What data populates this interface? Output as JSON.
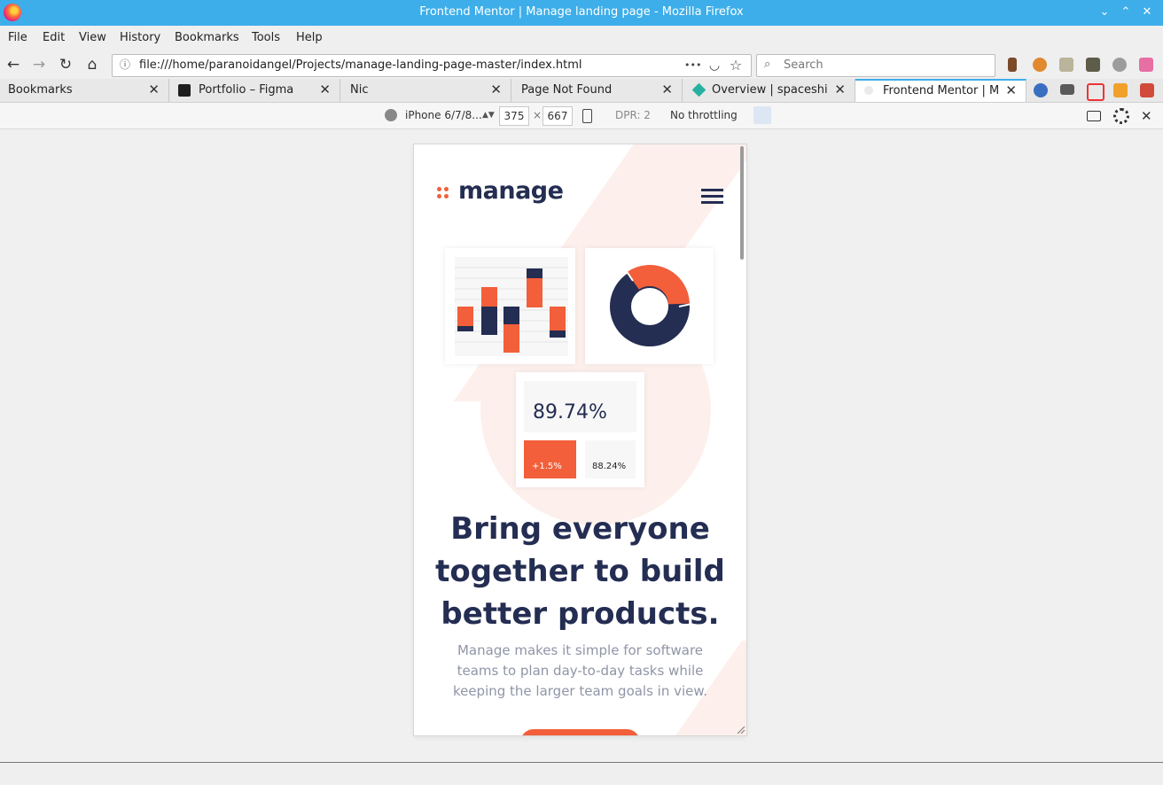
{
  "window": {
    "title": "Frontend Mentor | Manage landing page - Mozilla Firefox",
    "min_glyph": "⌄",
    "max_glyph": "⌃",
    "close_glyph": "✕"
  },
  "menu": {
    "items": [
      "File",
      "Edit",
      "View",
      "History",
      "Bookmarks",
      "Tools",
      "Help"
    ]
  },
  "nav": {
    "back_glyph": "←",
    "forward_glyph": "→",
    "reload_glyph": "↻",
    "home_glyph": "⌂",
    "info_glyph": "ⓘ",
    "url": "file:///home/paranoidangel/Projects/manage-landing-page-master/index.html",
    "more_glyph": "•••",
    "pocket_glyph": "◡",
    "star_glyph": "☆",
    "search_glyph": "⌕",
    "search_placeholder": "Search"
  },
  "tabs": [
    {
      "label": "Bookmarks",
      "active": false
    },
    {
      "label": "Portfolio – Figma",
      "active": false
    },
    {
      "label": "Nic",
      "active": false
    },
    {
      "label": "Page Not Found",
      "active": false
    },
    {
      "label": "Overview | spaceship",
      "active": false
    },
    {
      "label": "Frontend Mentor | Ma",
      "active": true
    }
  ],
  "tab_close_glyph": "✕",
  "rdm": {
    "device": "iPhone 6/7/8...",
    "width": "375",
    "times": "×",
    "height": "667",
    "dpr": "DPR: 2",
    "throttling": "No throttling",
    "close_glyph": "✕"
  },
  "page": {
    "logo": "manage",
    "stat_main": "89.74%",
    "stat_change": "+1.5%",
    "stat_secondary": "88.24%",
    "headline": [
      "Bring everyone",
      "together to build",
      "better products."
    ],
    "subtext": [
      "Manage makes it simple for software",
      "teams to plan day-to-day tasks while",
      "keeping the larger team goals in view."
    ]
  },
  "colors": {
    "accent": "#f25f3a",
    "navy": "#242d52",
    "tint": "#fdf0ec",
    "kde_blue": "#3daee9"
  }
}
